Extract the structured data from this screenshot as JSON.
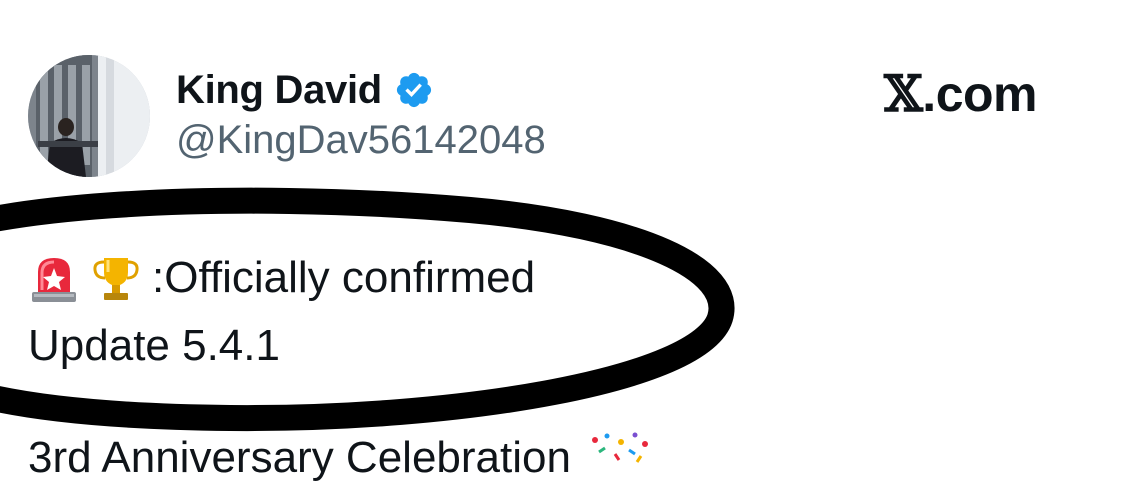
{
  "tweet": {
    "author": {
      "display_name": "King David",
      "handle": "@KingDav56142048",
      "verified_icon": "verified-badge-icon",
      "avatar": "profile-photo"
    },
    "brand_label": "X.com",
    "brand_x": "𝕏",
    "brand_suffix": ".com",
    "line1_emojis": [
      "police-siren-emoji",
      "trophy-emoji"
    ],
    "line1_text": ":Officially confirmed",
    "line2_text": "Update 5.4.1",
    "line3_text_partial": "3rd Anniversary Celebration",
    "line3_emoji": "confetti-emoji"
  },
  "colors": {
    "text": "#0f1419",
    "secondary_text": "#536471",
    "verified_blue": "#1d9bf0",
    "annotation_ellipse": "#000000",
    "siren_red": "#e8283c",
    "trophy_gold": "#f4b400"
  },
  "annotation": {
    "shape": "ellipse",
    "description": "hand-drawn black ellipse around first two lines of tweet text"
  }
}
